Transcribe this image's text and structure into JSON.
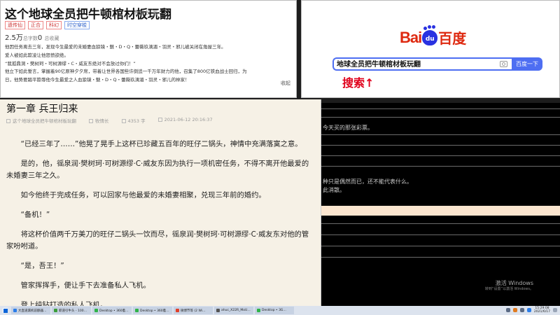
{
  "book": {
    "title": "这个地球全员把牛顿棺材板玩翻",
    "author": "牧情长 著",
    "tags": [
      "遗传仙",
      "正合",
      "科幻",
      "时空穿梭"
    ],
    "word_count": "2.5万",
    "word_count_label": "总字数",
    "word_count_suffix": "0",
    "word_count_unit": "总收藏",
    "desc": [
      "他因任务离去三年，发现今生最爱的未婚妻血狼镜・魅・D・Q・蕾薇玖漓湄・羽灵・邪儿被关闭在角屋三年。",
      "爱人被如此欺凌让他怒愤欲绝。",
      "“我孤鼎洞・樊树珂・可树源缪・C・威友东绝对不会放过你们！”",
      "他立下如此誓言，掌握着90亿原神夕夕席，带着让世界各国些许倒追一千万年财力的他，召集了800亿铁血战士回归，为",
      "日，他势要踏平欺辱他今生最爱之人血狼镜・魅・D・Q・蕾薇玖漓湄・羽灵・邪儿的林家！"
    ],
    "collapse": "收起"
  },
  "baidu": {
    "logo_bai": "Bai",
    "logo_du": "du",
    "logo_cn": "百度",
    "search_value": "地球全员把牛顿棺材板玩翻",
    "search_button": "百度一下",
    "annotation": "搜索↑"
  },
  "dark": {
    "line1": "今天买的那张彩票。",
    "line2": "种只是偶然而已，还不能代表什么。",
    "line3": "此消散。",
    "activate_title": "激活 Windows",
    "activate_sub": "转到“设置”以激活 Windows。"
  },
  "chapter": {
    "title": "第一章 兵王归来",
    "meta_book": "这个地球全员把牛顿棺材板玩翻",
    "meta_author": "牧情长",
    "meta_words": "4353 字",
    "meta_time": "2021-06-12 20:16:37",
    "paragraphs": [
      "“已经三年了……”他晃了晃手上这杯已珍藏五百年的旺仔二锅头，神情中充满落寞之意。",
      "是的，他，徭泉润·樊树珂·可树源缪·C·威友东因为执行一项机密任务，不得不离开他最爱的未婚妻三年之久。",
      "如今他终于完成任务，可以回家与他最爱的未婚妻相聚，兑现三年前的婚约。",
      "“备机！”",
      "将这杯价值两千万美刀的旺仔二锅头一饮而尽，徭泉润·樊树珂·可树源缪·C·威友东对他的管家吩咐道。",
      "“是，吾王！”",
      "管家挥挥手，便让手下去准备私人飞机。",
      "登上纯钻打造的私人飞机。"
    ]
  },
  "taskbar": {
    "items": [
      "大直道漏机前额器…",
      "职道引牛头 - 100…",
      "Desktop • 360着…",
      "Desktop • 360着…",
      "微博节等 (2 Wi…",
      "ahuc_X22R_MoU…",
      "Desktop • 3G…"
    ],
    "clock_time": "15:29:08",
    "clock_date": "2021/6/17"
  }
}
